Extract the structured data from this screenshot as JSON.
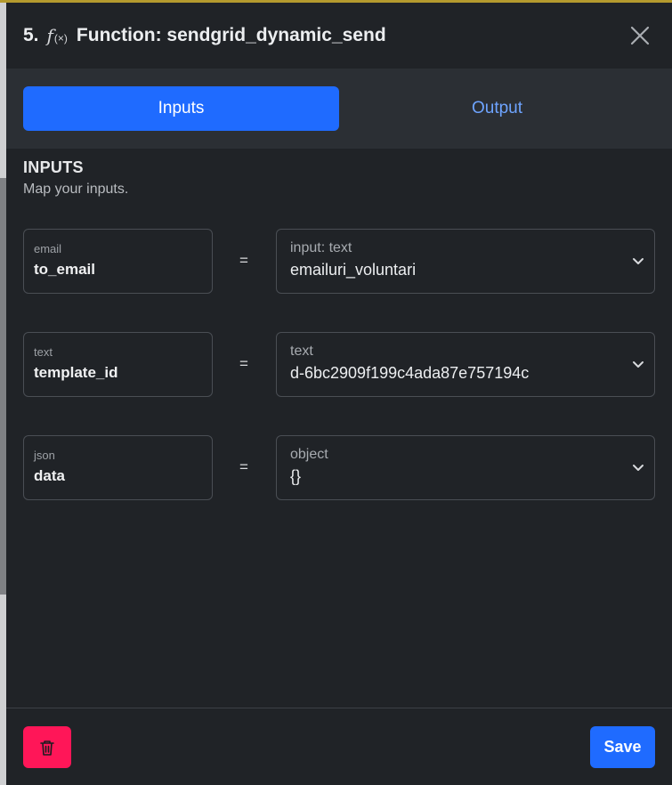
{
  "header": {
    "step": "5.",
    "fx_symbol": "f",
    "fx_args": "(×)",
    "title": "Function: sendgrid_dynamic_send",
    "close_icon": "close-icon"
  },
  "tabs": [
    {
      "label": "Inputs",
      "active": true
    },
    {
      "label": "Output",
      "active": false
    }
  ],
  "inputs_section": {
    "title": "INPUTS",
    "subtitle": "Map your inputs."
  },
  "rows": [
    {
      "type": "email",
      "name": "to_email",
      "equals": "=",
      "value_type": "input: text",
      "value": "emailuri_voluntari"
    },
    {
      "type": "text",
      "name": "template_id",
      "equals": "=",
      "value_type": "text",
      "value": "d-6bc2909f199c4ada87e757194c"
    },
    {
      "type": "json",
      "name": "data",
      "equals": "=",
      "value_type": "object",
      "value": "{}"
    }
  ],
  "footer": {
    "delete_icon": "trash-icon",
    "save_label": "Save"
  },
  "colors": {
    "primary": "#1f6bff",
    "danger": "#ff1658",
    "panel_bg": "#202327",
    "tab_bar_bg": "#2b2f34",
    "link": "#6ea4ff"
  }
}
